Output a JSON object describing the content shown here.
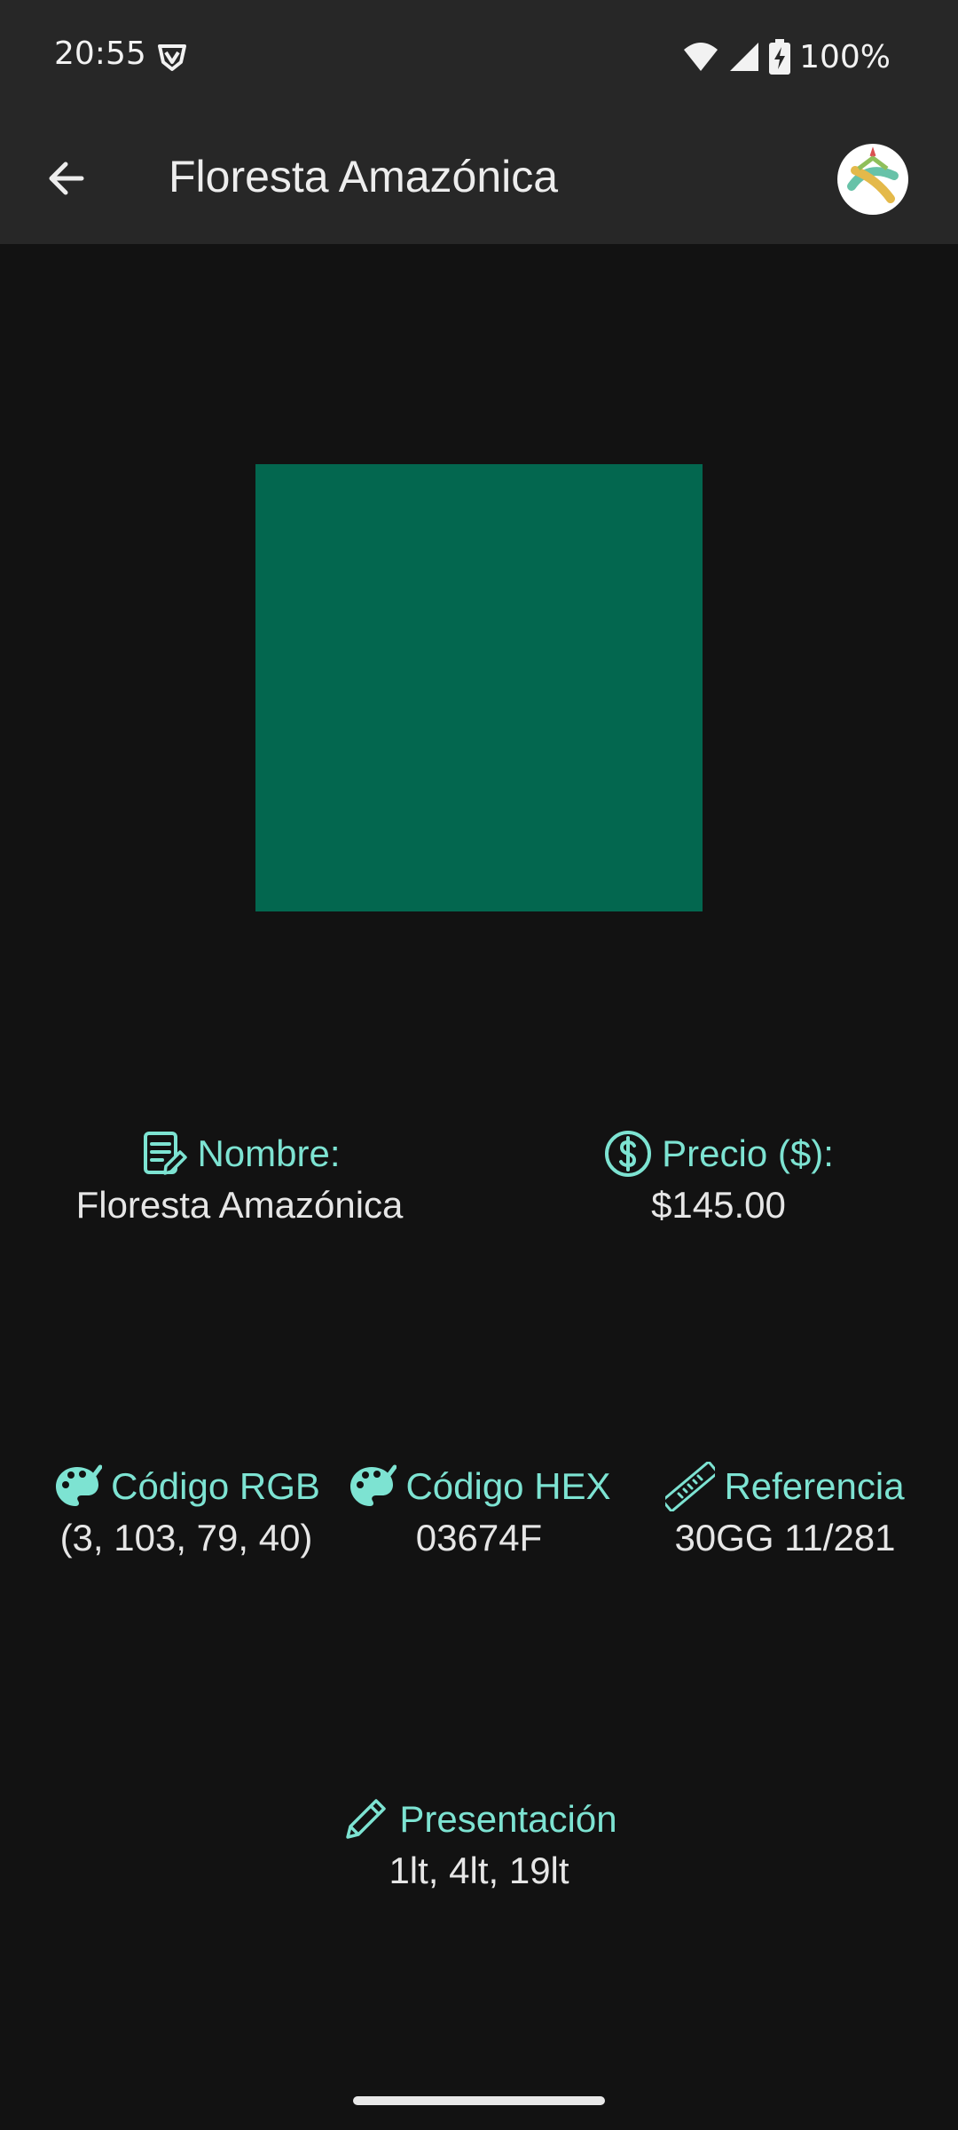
{
  "status_bar": {
    "time": "20:55",
    "battery": "100%",
    "icons": [
      "vpn-shield-icon",
      "wifi-icon",
      "cell-signal-icon",
      "battery-charging-icon"
    ]
  },
  "app_bar": {
    "title": "Floresta Amazónica",
    "back_icon": "arrow-back-icon",
    "avatar_icon": "app-logo-icon"
  },
  "color": {
    "hex": "#03674F"
  },
  "fields": {
    "nombre": {
      "label": "Nombre:",
      "value": "Floresta Amazónica",
      "icon": "notes-edit-icon"
    },
    "precio": {
      "label": "Precio ($):",
      "value": "$145.00",
      "icon": "dollar-circle-icon"
    },
    "rgb": {
      "label": "Código RGB",
      "value": "(3, 103, 79, 40)",
      "icon": "palette-icon"
    },
    "hex": {
      "label": "Código HEX",
      "value": "03674F",
      "icon": "palette-icon"
    },
    "referencia": {
      "label": "Referencia",
      "value": "30GG 11/281",
      "icon": "ruler-icon"
    },
    "presentacion": {
      "label": "Presentación",
      "value": "1lt, 4lt, 19lt",
      "icon": "pencil-icon"
    }
  },
  "accent_color": "#7DE3D2"
}
